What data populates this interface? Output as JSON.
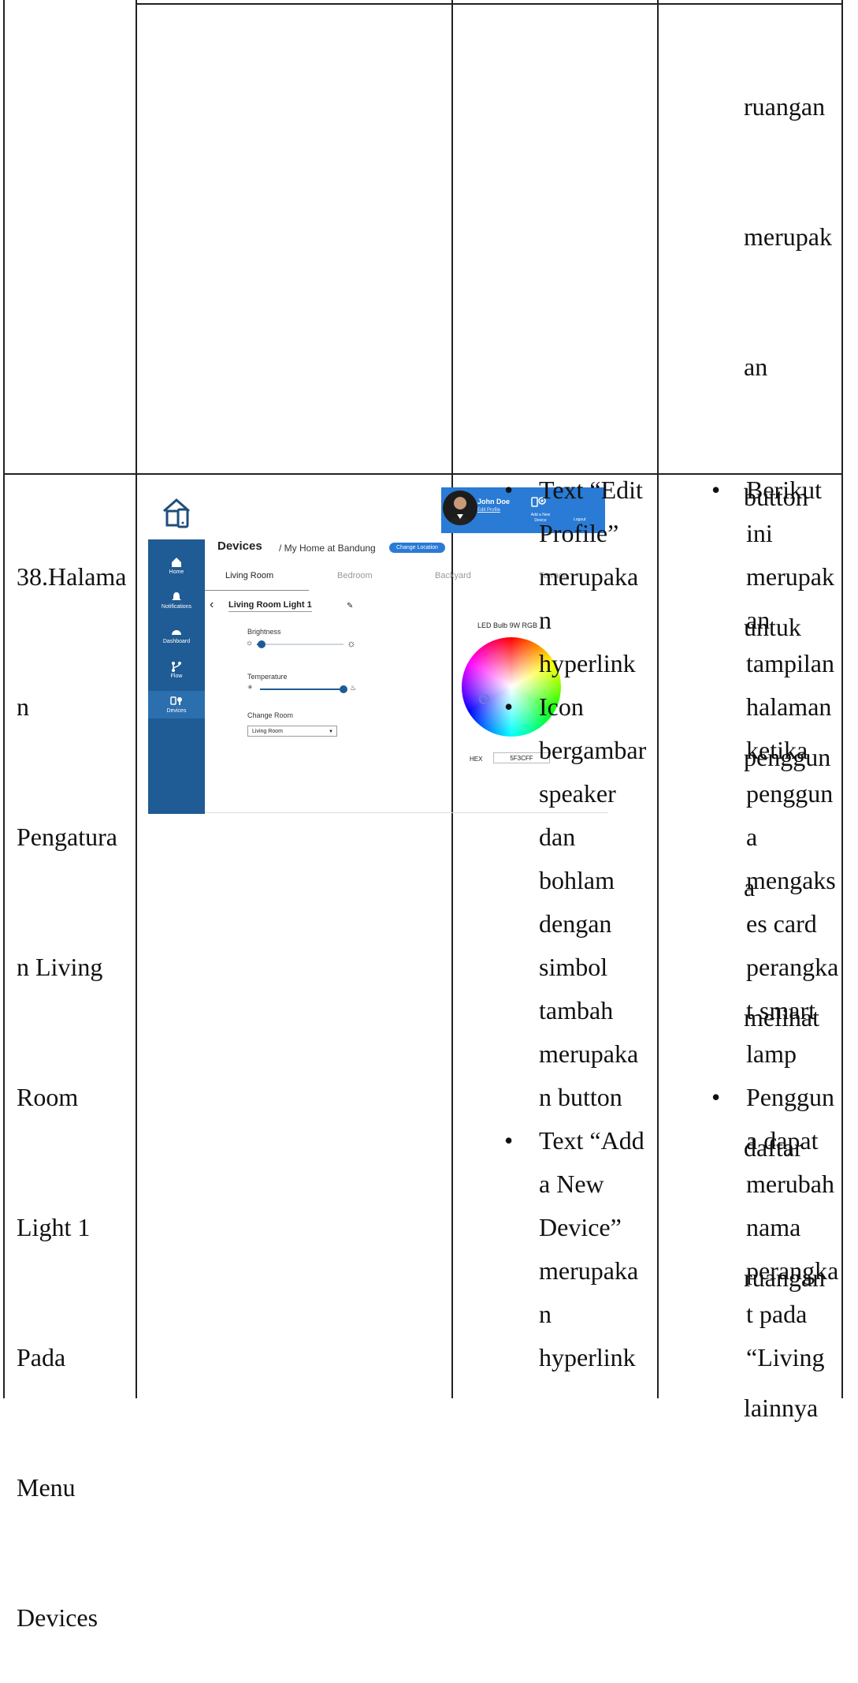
{
  "row_top": {
    "col4_lines": [
      "ruangan",
      "merupak",
      "an",
      "button",
      "untuk",
      "penggun",
      "a",
      "melihat",
      "daftar",
      "ruangan",
      "lainnya"
    ]
  },
  "row_bottom": {
    "col1_lines": [
      "38.Halama",
      "n",
      "Pengatura",
      "n Living",
      "Room",
      "Light 1",
      "Pada",
      "Menu",
      "Devices"
    ],
    "col3_items": [
      {
        "lines": [
          "Text “Edit",
          "Profile”",
          "merupaka",
          "n",
          "hyperlink"
        ]
      },
      {
        "lines": [
          "Icon",
          "bergambar",
          "speaker",
          "dan",
          "bohlam",
          "dengan",
          "simbol",
          "tambah",
          "merupaka",
          "n button"
        ]
      },
      {
        "lines": [
          "Text “Add",
          "a New",
          "Device”",
          "merupaka",
          "n",
          "hyperlink"
        ]
      }
    ],
    "col4_items": [
      {
        "lines": [
          "Berikut",
          "ini",
          "merupak",
          "an",
          "tampilan",
          "halaman",
          "ketika",
          "penggun",
          "a",
          "mengaks",
          "es card",
          "perangka",
          "t smart",
          "lamp"
        ]
      },
      {
        "lines": [
          "Penggun",
          "a dapat",
          "merubah",
          "nama",
          "perangka",
          "t pada",
          "“Living"
        ]
      }
    ]
  },
  "screenshot": {
    "sidebar": [
      "Home",
      "Notifications",
      "Dashboard",
      "Flow",
      "Devices"
    ],
    "title": "Devices",
    "breadcrumb": "/ My Home at Bandung",
    "change_location": "Change Location",
    "tabs": [
      "Living Room",
      "Bedroom",
      "Backyard",
      "Terrace"
    ],
    "device_name": "Living Room Light 1",
    "brightness_label": "Brightness",
    "brightness_level": 0.05,
    "temperature_label": "Temperature",
    "temperature_level": 1.0,
    "change_room_label": "Change Room",
    "change_room_value": "Living Room",
    "led_label": "LED Bulb 9W RGB",
    "hex_label": "HEX",
    "hex_value": "5F3CFF",
    "user_name": "John Doe",
    "edit_profile": "Edit Profile",
    "add_device": "Add a New Device",
    "logout": "Logout",
    "accent_color": "#1f5b94",
    "button_color": "#2a7bd5"
  }
}
